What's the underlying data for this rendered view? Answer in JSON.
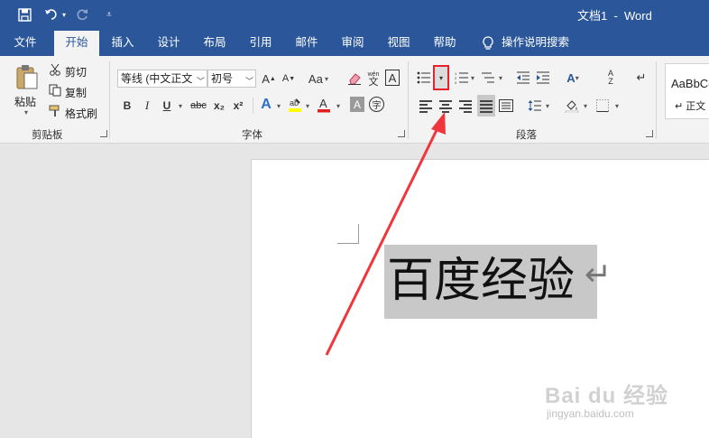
{
  "window": {
    "title": "文档1  -  Word"
  },
  "tabs": [
    {
      "label": "文件"
    },
    {
      "label": "开始"
    },
    {
      "label": "插入"
    },
    {
      "label": "设计"
    },
    {
      "label": "布局"
    },
    {
      "label": "引用"
    },
    {
      "label": "邮件"
    },
    {
      "label": "审阅"
    },
    {
      "label": "视图"
    },
    {
      "label": "帮助"
    }
  ],
  "tell_me": "操作说明搜索",
  "clipboard": {
    "paste": "粘贴",
    "cut": "剪切",
    "copy": "复制",
    "format_painter": "格式刷",
    "group_label": "剪贴板"
  },
  "font": {
    "font_name": "等线 (中文正文",
    "font_size": "初号",
    "aa_label": "Aa",
    "bold": "B",
    "italic": "I",
    "underline": "U",
    "strike": "abc",
    "subscript": "x₂",
    "superscript": "x²",
    "group_label": "字体"
  },
  "paragraph": {
    "group_label": "段落"
  },
  "styles": {
    "preview": "AaBbCc",
    "name": "↵ 正文"
  },
  "document": {
    "text": "百度经验",
    "paragraph_mark": "↵"
  },
  "watermark": {
    "brand": "Bai du 经验",
    "url": "jingyan.baidu.com"
  },
  "colors": {
    "accent": "#2b579a",
    "highlight_box": "#e8212a",
    "selection": "#c8c8c8"
  }
}
